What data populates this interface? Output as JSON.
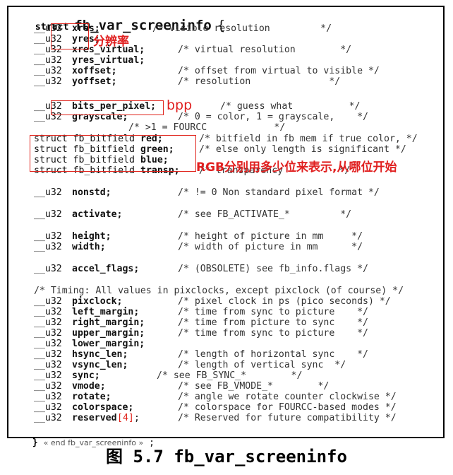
{
  "code": {
    "header": {
      "kw": "struct",
      "name": "fb_var_screeninfo",
      "brace": "{"
    },
    "lines": [
      {
        "t": "__u32",
        "f": "xres;",
        "c": "/* visible resolution         */"
      },
      {
        "t": "__u32",
        "f": "yres;",
        "c": ""
      },
      {
        "t": "__u32",
        "f": "xres_virtual;",
        "c": "/* virtual resolution        */"
      },
      {
        "t": "__u32",
        "f": "yres_virtual;",
        "c": ""
      },
      {
        "t": "__u32",
        "f": "xoffset;",
        "c": "/* offset from virtual to visible */"
      },
      {
        "t": "__u32",
        "f": "yoffset;",
        "c": "/* resolution              */"
      },
      {
        "t": "__u32",
        "f": "bits_per_pixel;",
        "c": "/* guess what          */"
      },
      {
        "t": "__u32",
        "f": "grayscale;",
        "c": "/* 0 = color, 1 = grayscale,    */"
      },
      {
        "t": "",
        "f": "",
        "c": "/* >1 = FOURCC            */"
      },
      {
        "t": "struct fb_bitfield",
        "f": "red;",
        "c": "/* bitfield in fb mem if true color, */"
      },
      {
        "t": "struct fb_bitfield",
        "f": "green;",
        "c": "/* else only length is significant */"
      },
      {
        "t": "struct fb_bitfield",
        "f": "blue;",
        "c": ""
      },
      {
        "t": "struct fb_bitfield",
        "f": "transp;",
        "c": "/* transparency          */"
      },
      {
        "t": "__u32",
        "f": "nonstd;",
        "c": "/* != 0 Non standard pixel format */"
      },
      {
        "t": "__u32",
        "f": "activate;",
        "c": "/* see FB_ACTIVATE_*         */"
      },
      {
        "t": "__u32",
        "f": "height;",
        "c": "/* height of picture in mm     */"
      },
      {
        "t": "__u32",
        "f": "width;",
        "c": "/* width of picture in mm      */"
      },
      {
        "t": "__u32",
        "f": "accel_flags;",
        "c": "/* (OBSOLETE) see fb_info.flags */"
      },
      {
        "t": "",
        "f": "",
        "c": "/* Timing: All values in pixclocks, except pixclock (of course) */"
      },
      {
        "t": "__u32",
        "f": "pixclock;",
        "c": "/* pixel clock in ps (pico seconds) */"
      },
      {
        "t": "__u32",
        "f": "left_margin;",
        "c": "/* time from sync to picture    */"
      },
      {
        "t": "__u32",
        "f": "right_margin;",
        "c": "/* time from picture to sync    */"
      },
      {
        "t": "__u32",
        "f": "upper_margin;",
        "c": "/* time from sync to picture    */"
      },
      {
        "t": "__u32",
        "f": "lower_margin;",
        "c": ""
      },
      {
        "t": "__u32",
        "f": "hsync_len;",
        "c": "/* length of horizontal sync    */"
      },
      {
        "t": "__u32",
        "f": "vsync_len;",
        "c": "/* length of vertical sync  */"
      },
      {
        "t": "__u32",
        "f": "sync;",
        "c": "/* see FB_SYNC_*        */"
      },
      {
        "t": "__u32",
        "f": "vmode;",
        "c": "/* see FB_VMODE_*        */"
      },
      {
        "t": "__u32",
        "f": "rotate;",
        "c": "/* angle we rotate counter clockwise */"
      },
      {
        "t": "__u32",
        "f": "colorspace;",
        "c": "/* colorspace for FOURCC-based modes */"
      },
      {
        "t": "__u32",
        "f": "reserved",
        "idx": "[4]",
        "semi": ";",
        "c": "/* Reserved for future compatibility */"
      }
    ],
    "footer": {
      "brace": "}",
      "end": "« end fb_var_screeninfo »",
      "semi": ";"
    }
  },
  "annotations": {
    "resolution": "分辨率",
    "bpp": "bpp",
    "rgb": "RGB分别用多少位来表示,从哪位开始"
  },
  "caption": "图 5.7 fb_var_screeninfo",
  "colors": {
    "annotation": "#e0241c",
    "border": "#000000"
  }
}
